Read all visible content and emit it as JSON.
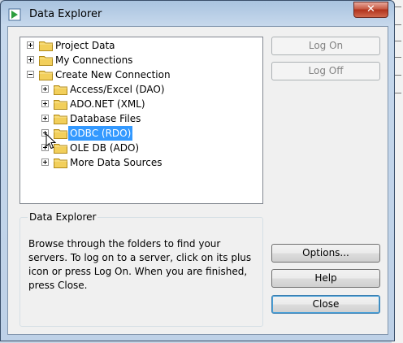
{
  "window": {
    "title": "Data Explorer",
    "close_glyph": "✕"
  },
  "tree": {
    "nodes": [
      {
        "label": "Project Data"
      },
      {
        "label": "My Connections"
      },
      {
        "label": "Create New Connection"
      },
      {
        "label": "Access/Excel (DAO)"
      },
      {
        "label": "ADO.NET (XML)"
      },
      {
        "label": "Database Files"
      },
      {
        "label": "ODBC (RDO)",
        "selected": true
      },
      {
        "label": "OLE DB (ADO)"
      },
      {
        "label": "More Data Sources"
      }
    ]
  },
  "buttons": {
    "log_on": "Log On",
    "log_off": "Log Off",
    "options": "Options...",
    "help": "Help",
    "close": "Close"
  },
  "description": {
    "title": "Data Explorer",
    "text": "Browse through the folders to find your servers.  To log on to a server, click on its plus icon or press Log On.  When you are finished, press Close."
  },
  "colors": {
    "selection": "#3399ff",
    "folder": "#f2cf5b"
  },
  "icons": [
    "app-icon",
    "close-icon",
    "folder-icon",
    "expand-icon",
    "collapse-icon",
    "mouse-cursor-icon"
  ]
}
